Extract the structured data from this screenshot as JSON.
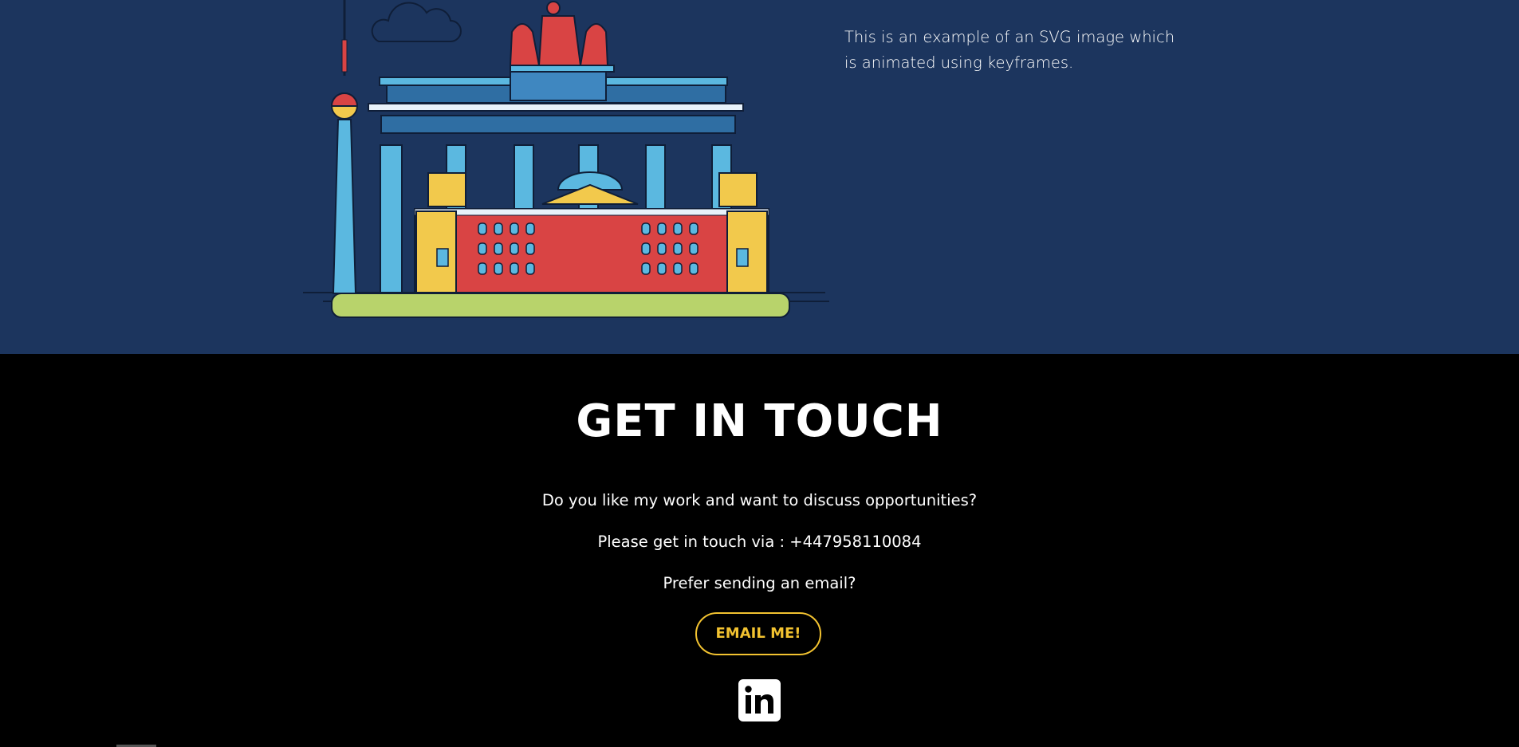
{
  "illustration": {
    "description_icon": "berlin-landmarks-illustration"
  },
  "top_section": {
    "description": "This is an example of an SVG image which is animated using keyframes."
  },
  "contact": {
    "title": "GET IN TOUCH",
    "line1": "Do you like my work and want to discuss opportunities?",
    "line2": "Please get in touch via : +447958110084",
    "line3": "Prefer sending an email?",
    "email_button": "EMAIL ME!",
    "linkedin_icon": "linkedin-icon"
  },
  "colors": {
    "top_bg": "#1c355e",
    "bottom_bg": "#000000",
    "accent": "#f2c230",
    "building_red": "#d94444",
    "building_yellow": "#f2c94c",
    "building_blue": "#5bb8e0",
    "ground_green": "#b8d36b"
  }
}
